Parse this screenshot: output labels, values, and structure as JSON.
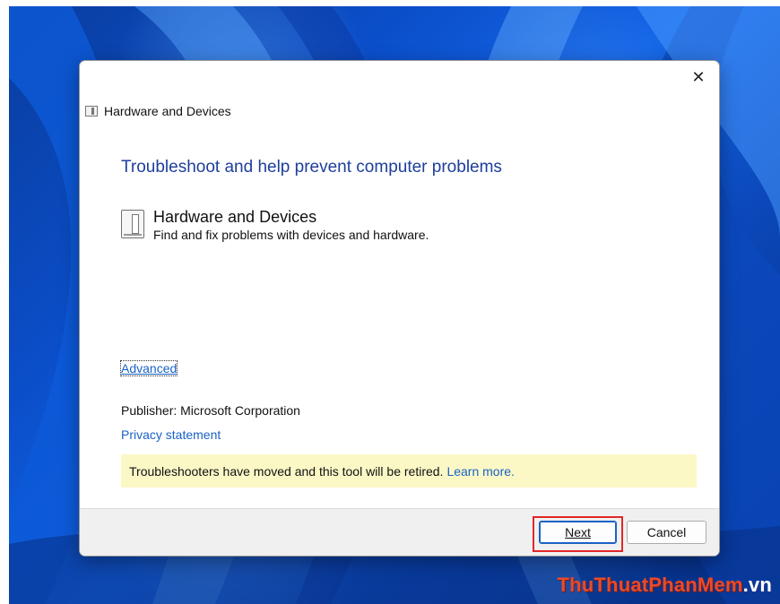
{
  "dialog": {
    "close_glyph": "✕",
    "title": "Hardware and Devices",
    "heading": "Troubleshoot and help prevent computer problems",
    "item": {
      "title": "Hardware and Devices",
      "description": "Find and fix problems with devices and hardware.",
      "icon": "hardware-icon"
    },
    "advanced_link": "Advanced",
    "publisher": "Publisher:  Microsoft Corporation",
    "privacy_link": "Privacy statement",
    "notice": {
      "text": "Troubleshooters have moved and this tool will be retired.",
      "link": "Learn more."
    },
    "buttons": {
      "next": "Next",
      "cancel": "Cancel"
    }
  },
  "watermark": {
    "part1": "ThuThuat",
    "part2": "PhanMem",
    "part3": ".vn"
  },
  "colors": {
    "heading": "#1e3e9c",
    "link": "#1a62c5",
    "notice_bg": "#fbf8c6",
    "highlight": "#e32626"
  }
}
